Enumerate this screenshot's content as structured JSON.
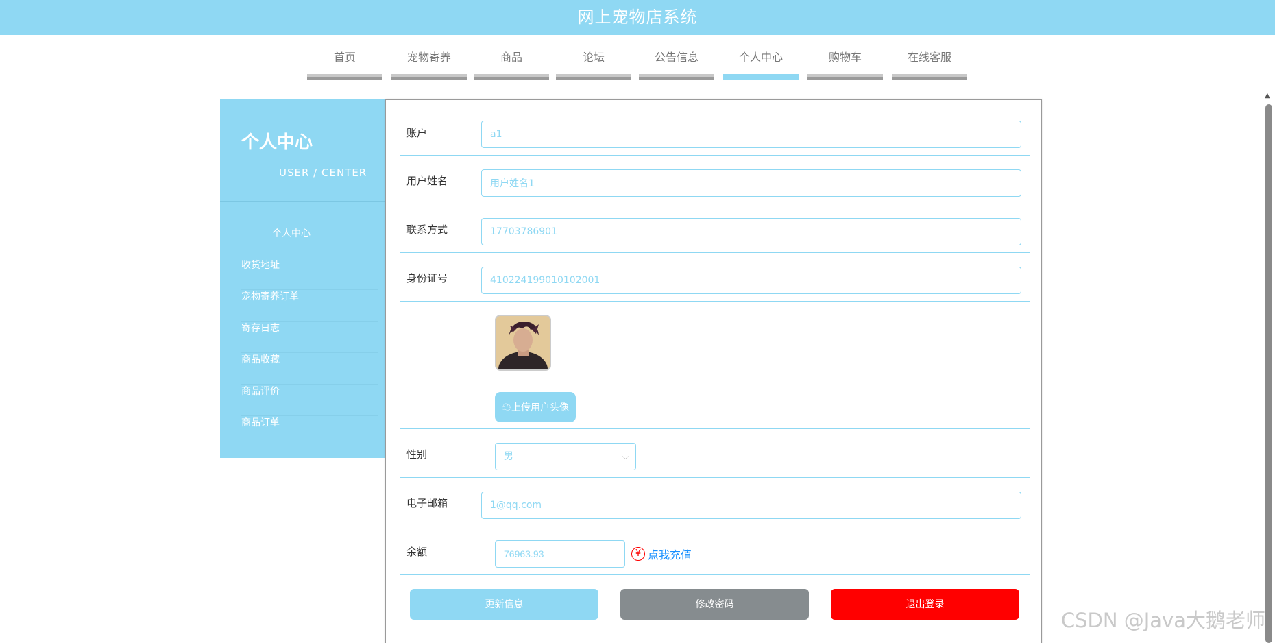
{
  "header": {
    "title": "网上宠物店系统"
  },
  "nav": {
    "tabs": [
      {
        "label": "首页"
      },
      {
        "label": "宠物寄养"
      },
      {
        "label": "商品"
      },
      {
        "label": "论坛"
      },
      {
        "label": "公告信息"
      },
      {
        "label": "个人中心"
      },
      {
        "label": "购物车"
      },
      {
        "label": "在线客服"
      }
    ],
    "active_tab": "个人中心"
  },
  "sidebar": {
    "title": "个人中心",
    "subtitle": "USER / CENTER",
    "active_item": "个人中心",
    "items": [
      {
        "label": "收货地址"
      },
      {
        "label": "宠物寄养订单"
      },
      {
        "label": "寄存日志"
      },
      {
        "label": "商品收藏"
      },
      {
        "label": "商品评价"
      },
      {
        "label": "商品订单"
      }
    ]
  },
  "form": {
    "account": {
      "label": "账户",
      "value": "a1"
    },
    "username": {
      "label": "用户姓名",
      "value": "用户姓名1"
    },
    "phone": {
      "label": "联系方式",
      "value": "17703786901"
    },
    "id_number": {
      "label": "身份证号",
      "value": "410224199010102001"
    },
    "upload_button": "上传用户头像",
    "gender": {
      "label": "性别",
      "value": "男"
    },
    "email": {
      "label": "电子邮箱",
      "value": "1@qq.com"
    },
    "balance": {
      "label": "余额",
      "value": "76963.93",
      "recharge_symbol": "¥",
      "recharge_label": "点我充值"
    }
  },
  "actions": {
    "update": "更新信息",
    "change_password": "修改密码",
    "logout": "退出登录"
  },
  "colors": {
    "primary": "#8fd8f3",
    "gray_button": "#868c8f",
    "danger": "#ff0000",
    "link": "#1890ff"
  },
  "icons": {
    "upload": "cloud-upload-icon",
    "recharge": "yen-circle-icon",
    "select": "chevron-down-icon"
  },
  "watermark": "CSDN @Java大鹅老师"
}
